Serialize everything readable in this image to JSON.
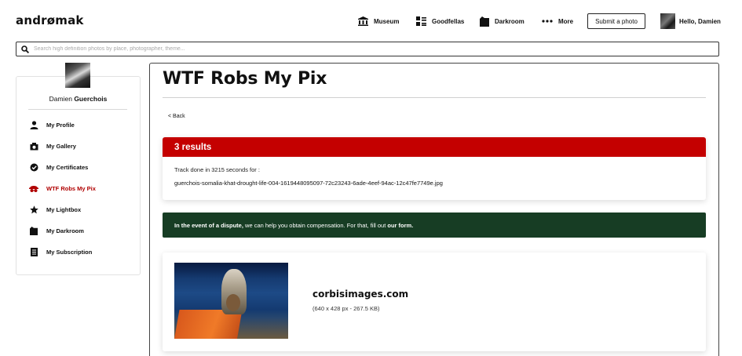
{
  "header": {
    "logo": "andrømak",
    "nav": [
      {
        "label": "Museum",
        "icon": "museum-icon"
      },
      {
        "label": "Goodfellas",
        "icon": "goodfellas-icon"
      },
      {
        "label": "Darkroom",
        "icon": "darkroom-icon"
      },
      {
        "label": "More",
        "icon": "more-dots-icon"
      }
    ],
    "submit_label": "Submit a photo",
    "greeting": "Hello, Damien"
  },
  "search": {
    "placeholder": "Search high definition photos by place, photographer, theme..."
  },
  "profile": {
    "first_name": "Damien",
    "last_name": "Guerchois"
  },
  "sidebar": {
    "items": [
      {
        "label": "My Profile",
        "icon": "user-icon",
        "active": false
      },
      {
        "label": "My Gallery",
        "icon": "gallery-icon",
        "active": false
      },
      {
        "label": "My Certificates",
        "icon": "certificate-icon",
        "active": false
      },
      {
        "label": "WTF Robs My Pix",
        "icon": "robber-icon",
        "active": true
      },
      {
        "label": "My Lightbox",
        "icon": "star-icon",
        "active": false
      },
      {
        "label": "My Darkroom",
        "icon": "darkroom-icon",
        "active": false
      },
      {
        "label": "My Subscription",
        "icon": "subscription-icon",
        "active": false
      }
    ]
  },
  "main": {
    "title": "WTF Robs My Pix",
    "back_label": "< Back",
    "results_title": "3 results",
    "track_text": "Track done in 3215 seconds for :",
    "filename": "guerchois-somalia-khat-drought-life-004-1619448095097-72c23243-6ade-4eef-94ac-12c47fe7749e.jpg",
    "dispute": {
      "bold": "In the event of a dispute,",
      "text": " we can help you obtain compensation. For that, fill out ",
      "link": "our form."
    },
    "match": {
      "site": "corbisimages.com",
      "meta": "(640 x 428 px - 267.5 KB)"
    }
  },
  "colors": {
    "accent_red": "#c40000",
    "dispute_green": "#173d24",
    "text": "#111111"
  }
}
